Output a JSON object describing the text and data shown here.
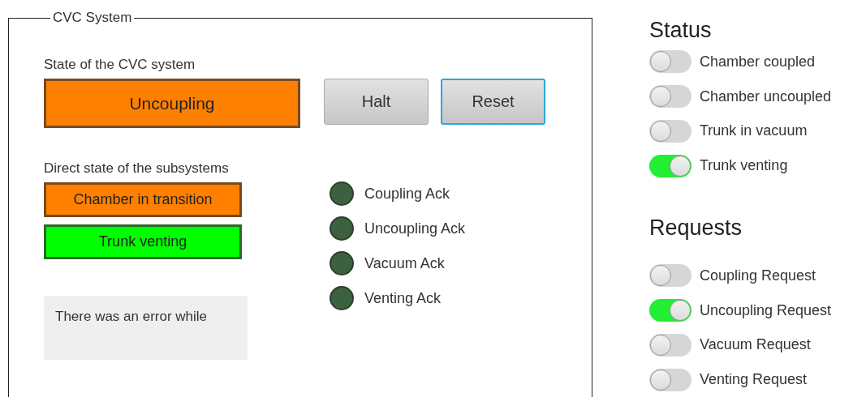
{
  "panel": {
    "legend": "CVC System",
    "system_state": {
      "label": "State of the CVC system",
      "value": "Uncoupling",
      "color": "#ff8000"
    },
    "buttons": [
      {
        "label": "Halt",
        "focused": false
      },
      {
        "label": "Reset",
        "focused": true
      }
    ],
    "subsystems": {
      "label": "Direct state of the subsystems",
      "states": [
        {
          "value": "Chamber in transition",
          "color": "#ff8000"
        },
        {
          "value": "Trunk venting",
          "color": "#00ff00"
        }
      ]
    },
    "error_message": "There was an error while",
    "acks": [
      {
        "label": "Coupling Ack",
        "on": false
      },
      {
        "label": "Uncoupling Ack",
        "on": false
      },
      {
        "label": "Vacuum Ack",
        "on": false
      },
      {
        "label": "Venting Ack",
        "on": false
      }
    ]
  },
  "status": {
    "title": "Status",
    "items": [
      {
        "label": "Chamber coupled",
        "on": false
      },
      {
        "label": "Chamber uncoupled",
        "on": false
      },
      {
        "label": "Trunk in vacuum",
        "on": false
      },
      {
        "label": "Trunk venting",
        "on": true
      }
    ]
  },
  "requests": {
    "title": "Requests",
    "items": [
      {
        "label": "Coupling Request",
        "on": false
      },
      {
        "label": "Uncoupling Request",
        "on": true
      },
      {
        "label": "Vacuum Request",
        "on": false
      },
      {
        "label": "Venting Request",
        "on": false
      }
    ]
  }
}
